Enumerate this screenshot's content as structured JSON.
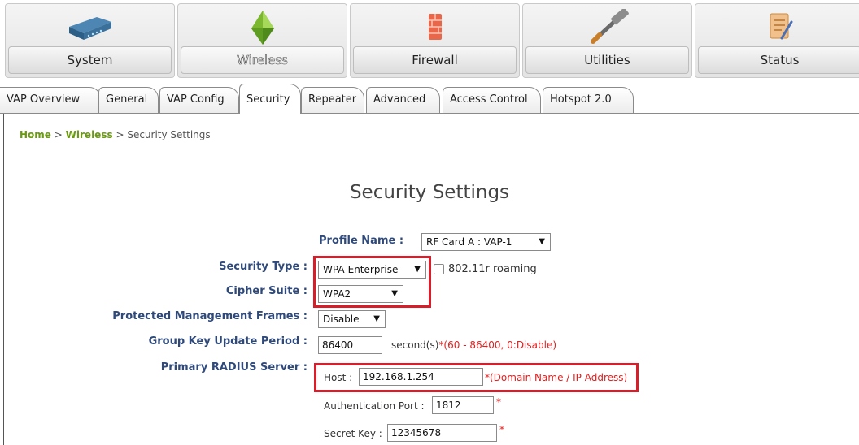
{
  "nav": [
    {
      "label": "System",
      "icon": "router-icon"
    },
    {
      "label": "Wireless",
      "icon": "wireless-icon"
    },
    {
      "label": "Firewall",
      "icon": "firewall-icon"
    },
    {
      "label": "Utilities",
      "icon": "hammer-icon"
    },
    {
      "label": "Status",
      "icon": "notepad-icon"
    }
  ],
  "nav_active": "Wireless",
  "tabs": [
    "VAP Overview",
    "General",
    "VAP Config",
    "Security",
    "Repeater",
    "Advanced",
    "Access Control",
    "Hotspot 2.0"
  ],
  "tab_active": "Security",
  "breadcrumb": {
    "home": "Home",
    "sep1": ">",
    "wireless": "Wireless",
    "sep2": ">",
    "current": "Security Settings"
  },
  "title": "Security Settings",
  "form": {
    "profile_name_label": "Profile Name :",
    "profile_name_value": "RF Card A : VAP-1",
    "security_type_label": "Security Type :",
    "security_type_value": "WPA-Enterprise",
    "roaming_label": "802.11r roaming",
    "roaming_checked": false,
    "cipher_suite_label": "Cipher Suite :",
    "cipher_suite_value": "WPA2",
    "pmf_label": "Protected Management Frames :",
    "pmf_value": "Disable",
    "gkup_label": "Group Key Update Period :",
    "gkup_value": "86400",
    "gkup_unit": "second(s)",
    "gkup_hint": "*(60 - 86400, 0:Disable)",
    "radius_label": "Primary RADIUS Server :",
    "host_label": "Host :",
    "host_value": "192.168.1.254",
    "host_hint": "*(Domain Name / IP Address)",
    "auth_port_label": "Authentication Port :",
    "auth_port_value": "1812",
    "auth_port_required": "*",
    "secret_key_label": "Secret Key :",
    "secret_key_value": "12345678",
    "secret_key_required": "*"
  },
  "colors": {
    "highlight": "#d81e2a",
    "label": "#2f4a7a",
    "breadcrumb_link": "#6a9a0e",
    "required": "#e02020"
  }
}
